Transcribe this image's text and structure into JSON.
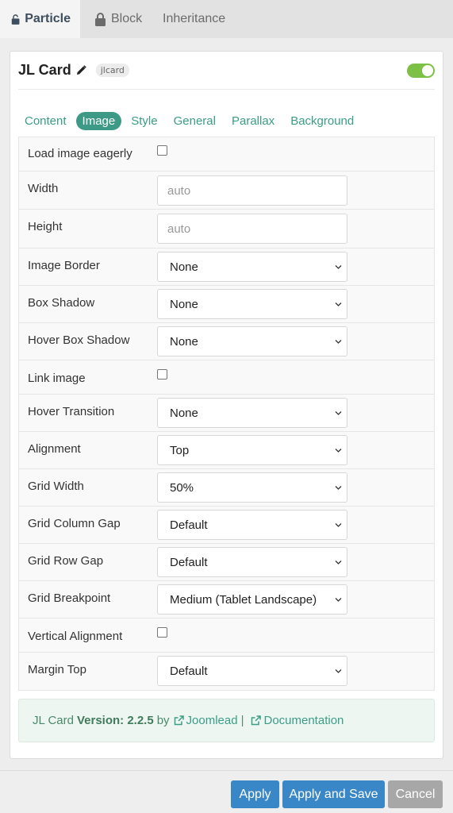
{
  "top_tabs": [
    {
      "label": "Particle",
      "icon": "unlock-icon",
      "active": true
    },
    {
      "label": "Block",
      "icon": "lock-icon",
      "active": false
    },
    {
      "label": "Inheritance",
      "active": false
    }
  ],
  "card": {
    "title": "JL Card",
    "tag": "jlcard",
    "enabled": true
  },
  "sub_tabs": [
    "Content",
    "Image",
    "Style",
    "General",
    "Parallax",
    "Background"
  ],
  "active_sub_tab": "Image",
  "fields": [
    {
      "label": "Load image eagerly",
      "type": "checkbox",
      "checked": false
    },
    {
      "label": "Width",
      "type": "input",
      "value": "",
      "placeholder": "auto"
    },
    {
      "label": "Height",
      "type": "input",
      "value": "",
      "placeholder": "auto"
    },
    {
      "label": "Image Border",
      "type": "select",
      "value": "None"
    },
    {
      "label": "Box Shadow",
      "type": "select",
      "value": "None"
    },
    {
      "label": "Hover Box Shadow",
      "type": "select",
      "value": "None"
    },
    {
      "label": "Link image",
      "type": "checkbox",
      "checked": false
    },
    {
      "label": "Hover Transition",
      "type": "select",
      "value": "None"
    },
    {
      "label": "Alignment",
      "type": "select",
      "value": "Top"
    },
    {
      "label": "Grid Width",
      "type": "select",
      "value": "50%"
    },
    {
      "label": "Grid Column Gap",
      "type": "select",
      "value": "Default"
    },
    {
      "label": "Grid Row Gap",
      "type": "select",
      "value": "Default"
    },
    {
      "label": "Grid Breakpoint",
      "type": "select",
      "value": "Medium (Tablet Landscape)"
    },
    {
      "label": "Vertical Alignment",
      "type": "checkbox",
      "checked": false
    },
    {
      "label": "Margin Top",
      "type": "select",
      "value": "Default"
    }
  ],
  "info": {
    "name": "JL Card",
    "version_label": "Version: 2.2.5",
    "by": "by",
    "author_link": "Joomlead",
    "separator": "|",
    "docs_link": "Documentation"
  },
  "buttons": {
    "apply": "Apply",
    "apply_save": "Apply and Save",
    "cancel": "Cancel"
  },
  "colors": {
    "accent": "#3d9a86",
    "primary_button": "#3a87c8",
    "toggle_on": "#7cc046"
  }
}
